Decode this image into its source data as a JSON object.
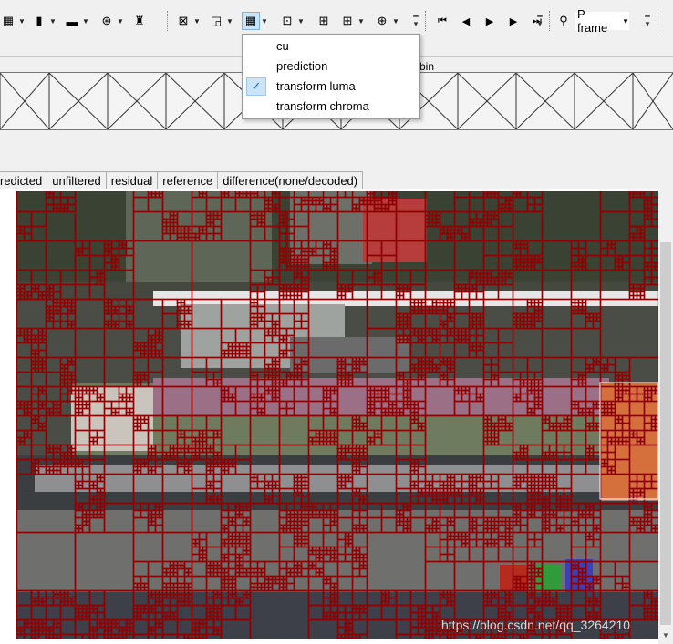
{
  "toolbar": {
    "icons": [
      {
        "name": "table-icon",
        "glyph": "▦",
        "dd": true
      },
      {
        "name": "bar-chart-icon",
        "glyph": "▮",
        "dd": true
      },
      {
        "name": "frame-icon",
        "glyph": "▬",
        "dd": true
      },
      {
        "name": "wheel-icon",
        "glyph": "⊛",
        "dd": true
      },
      {
        "name": "bug-icon",
        "glyph": "♜",
        "dd": false
      },
      {
        "name": "split-view-icon",
        "glyph": "⊠",
        "dd": true
      },
      {
        "name": "window-icon",
        "glyph": "◲",
        "dd": true
      },
      {
        "name": "grid-overlay-icon",
        "glyph": "▦",
        "dd": true,
        "active": true
      },
      {
        "name": "zoom-region-icon",
        "glyph": "⊡",
        "dd": true
      },
      {
        "name": "quad-grid-icon",
        "glyph": "⊞",
        "dd": false
      },
      {
        "name": "quad-grid-2-icon",
        "glyph": "⊞",
        "dd": true
      },
      {
        "name": "zoom-icon",
        "glyph": "⊕",
        "dd": true
      }
    ],
    "nav": {
      "first": "⏮",
      "prev": "◀",
      "play": "▶",
      "next": "▶",
      "last": "⏭"
    },
    "search_glyph": "⚲",
    "frame_type": "P frame"
  },
  "dropdown": {
    "items": [
      "cu",
      "prediction",
      "transform luma",
      "transform chroma"
    ],
    "checked_index": 2,
    "check_glyph": "✓"
  },
  "timeline": {
    "bin_label": "bin"
  },
  "tabs": [
    "redicted",
    "unfiltered",
    "residual",
    "reference",
    "difference(none/decoded)"
  ],
  "watermark": "https://blog.csdn.net/qq_3264210",
  "colors": {
    "grid": "#8b0000",
    "check_bg": "#cce4f7"
  }
}
